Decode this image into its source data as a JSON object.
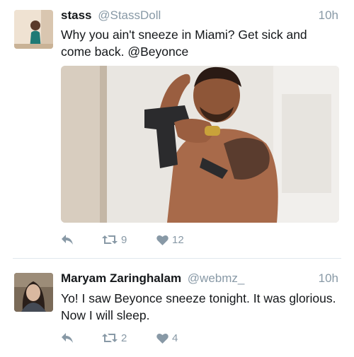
{
  "tweets": [
    {
      "name": "stass",
      "handle": "@StassDoll",
      "time": "10h",
      "text": "Why you ain't sneeze in Miami? Get sick and come back. @Beyonce",
      "has_media": true,
      "retweets": "9",
      "likes": "12",
      "icons": {
        "reply": "reply-icon",
        "retweet": "retweet-icon",
        "like": "heart-icon"
      }
    },
    {
      "name": "Maryam Zaringhalam",
      "handle": "@webmz_",
      "time": "10h",
      "text": "Yo! I saw Beyonce sneeze tonight. It was glorious. Now I will sleep.",
      "has_media": false,
      "retweets": "2",
      "likes": "4",
      "icons": {
        "reply": "reply-icon",
        "retweet": "retweet-icon",
        "like": "heart-icon"
      }
    }
  ],
  "colors": {
    "text": "#14171a",
    "secondary": "#8899a6",
    "divider": "#e1e8ed"
  }
}
